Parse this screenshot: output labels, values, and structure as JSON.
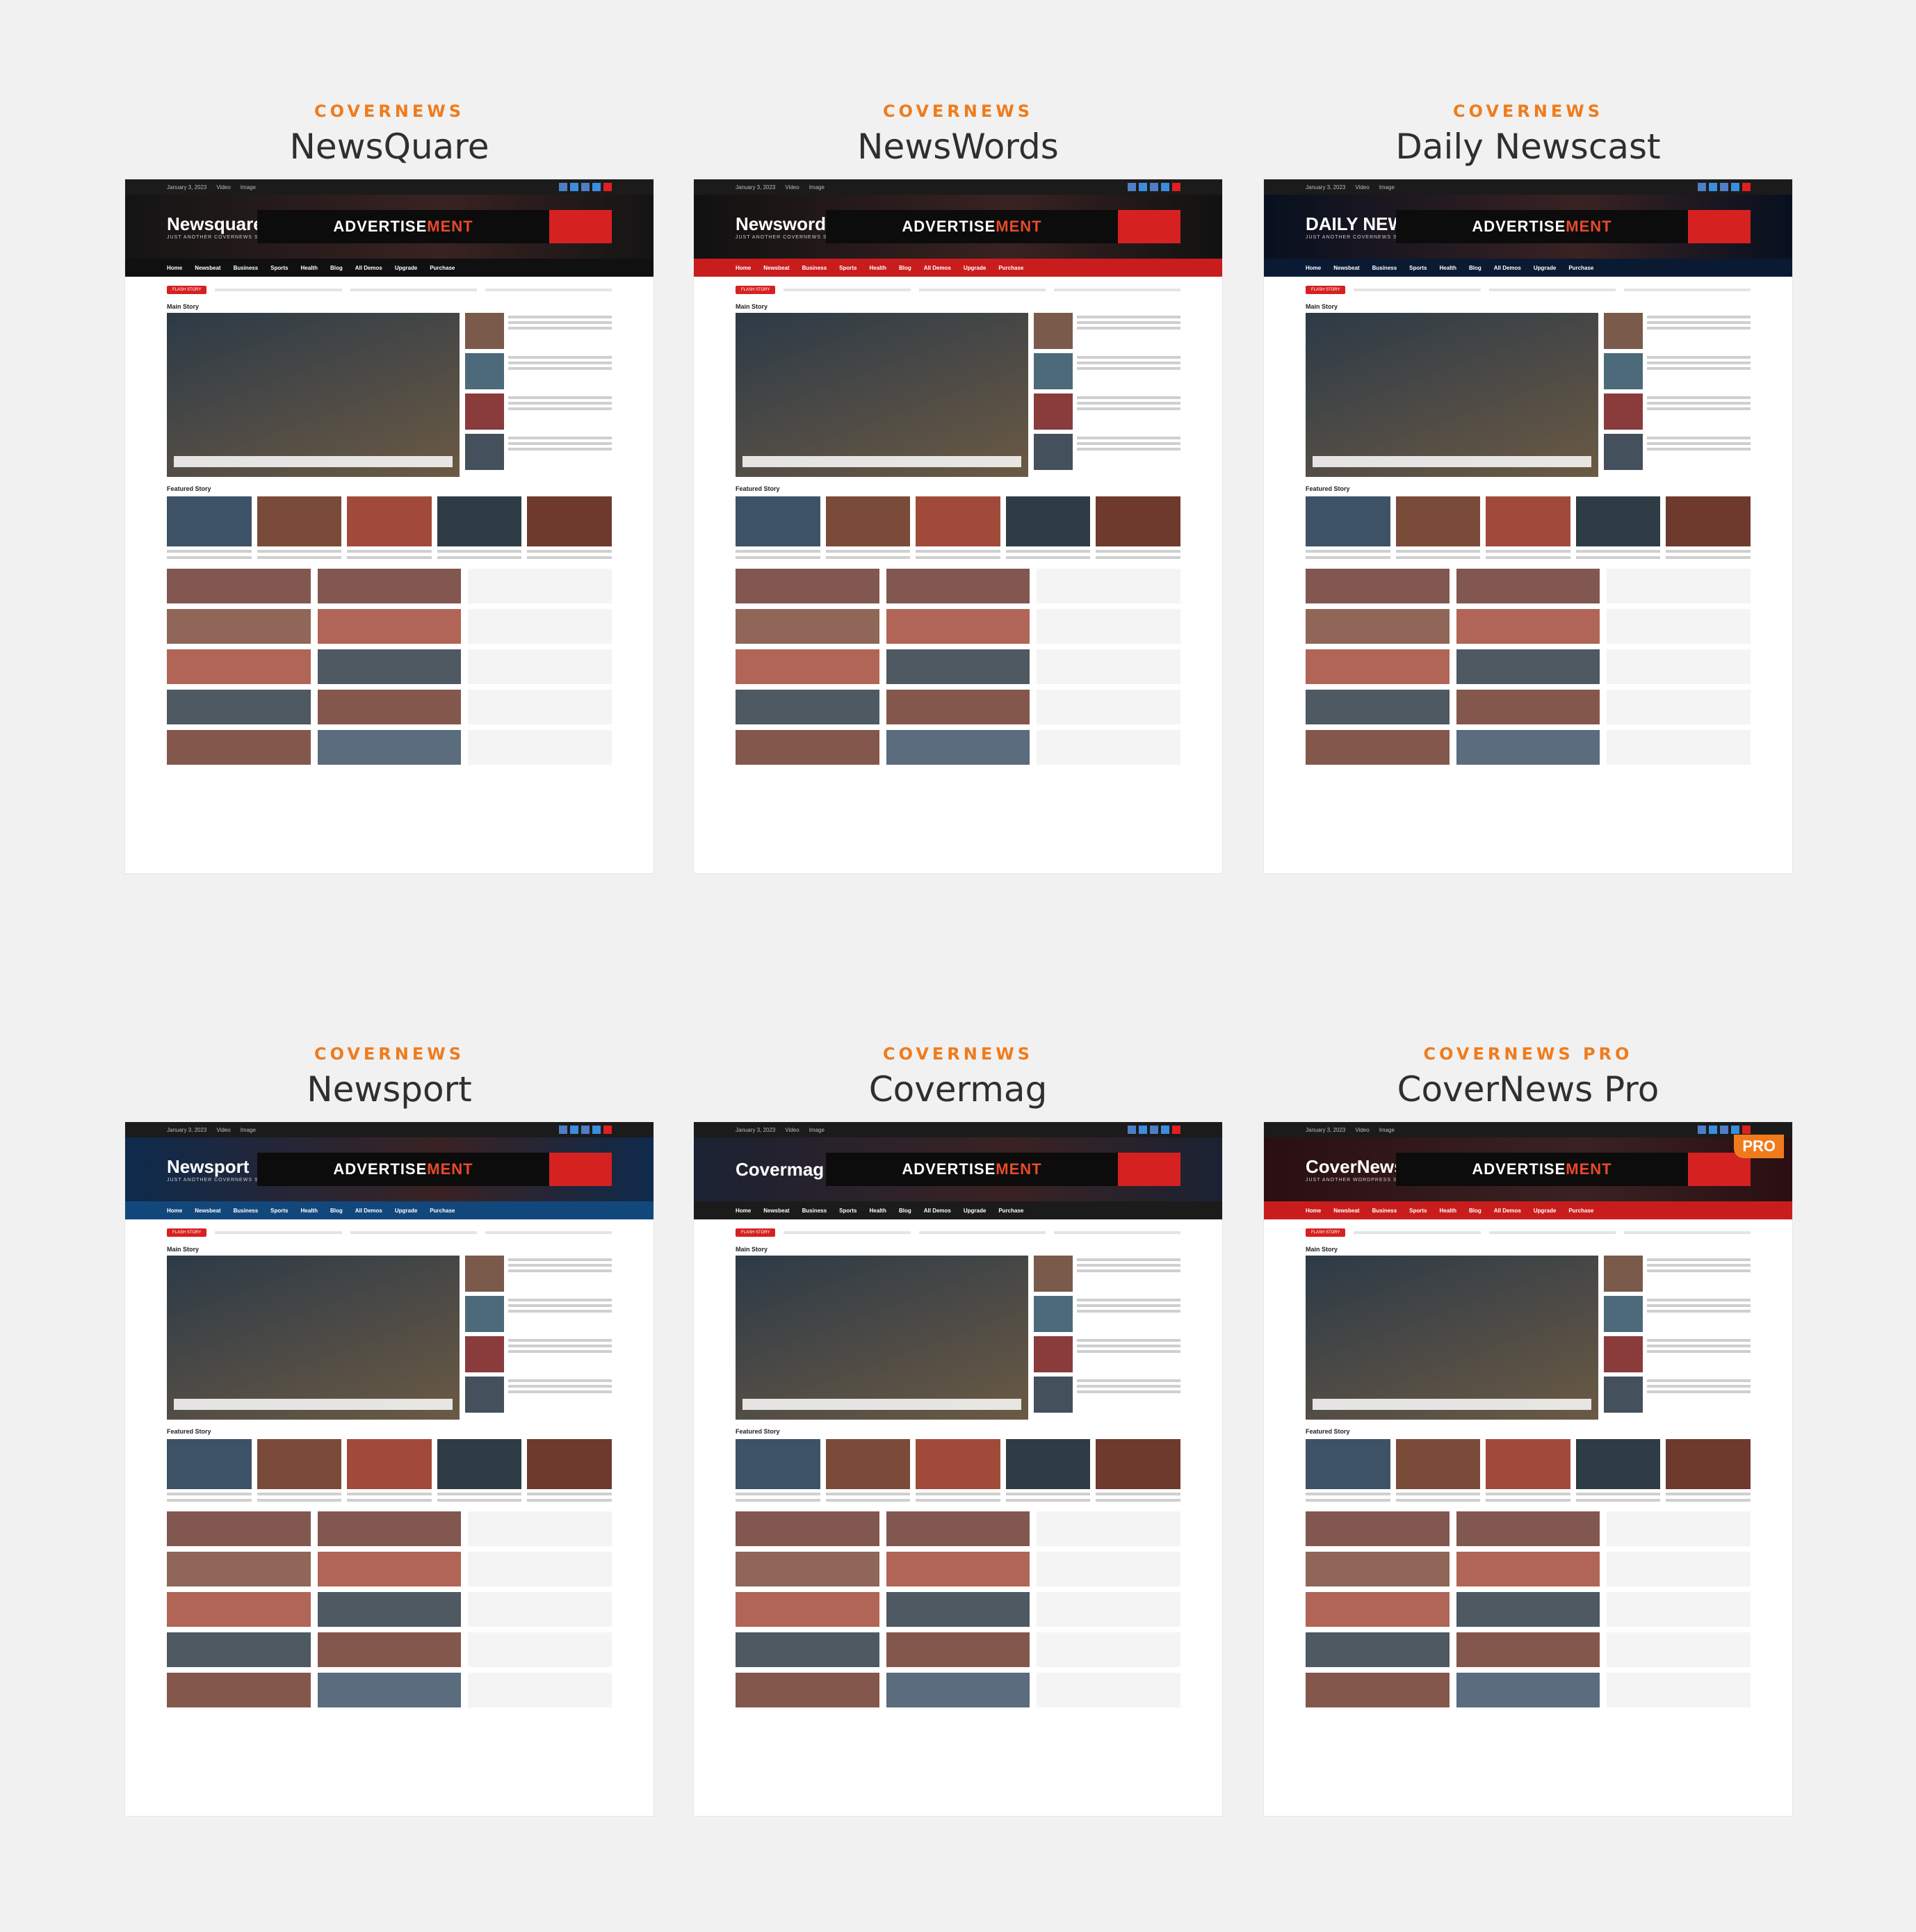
{
  "cards": [
    {
      "eyebrow": "COVERNEWS",
      "title": "NewsQuare",
      "site_name": "Newsquare",
      "tagline": "JUST ANOTHER COVERNEWS SITES SITE",
      "accent": "#d62121",
      "header_bg": "#141414",
      "nav_bg": "#101010"
    },
    {
      "eyebrow": "COVERNEWS",
      "title": "NewsWords",
      "site_name": "Newswords",
      "tagline": "JUST ANOTHER COVERNEWS SITES SITE",
      "accent": "#d62121",
      "header_bg": "#111111",
      "nav_bg": "#c91d1d"
    },
    {
      "eyebrow": "COVERNEWS",
      "title": "Daily Newscast",
      "site_name": "DAILY NEWSCAST",
      "tagline": "JUST ANOTHER COVERNEWS SITES SITE",
      "accent": "#d62121",
      "header_bg": "#07101f",
      "nav_bg": "#0b1a33"
    },
    {
      "eyebrow": "COVERNEWS",
      "title": "Newsport",
      "site_name": "Newsport",
      "tagline": "JUST ANOTHER COVERNEWS SITES SITE",
      "accent": "#d62121",
      "header_bg": "#0e2a4c",
      "nav_bg": "#12477c"
    },
    {
      "eyebrow": "COVERNEWS",
      "title": "Covermag",
      "site_name": "Covermag",
      "tagline": "",
      "accent": "#d62121",
      "header_bg": "#1a2233",
      "nav_bg": "#1b1b1b"
    },
    {
      "eyebrow": "COVERNEWS PRO",
      "title": "CoverNews Pro",
      "site_name": "CoverNews Pro",
      "tagline": "JUST ANOTHER WORDPRESS SITE",
      "accent": "#d62121",
      "header_bg": "#2a0f12",
      "nav_bg": "#c91d1d",
      "badge": "PRO"
    }
  ],
  "common": {
    "advert_prefix": "ADVERTISE",
    "advert_suffix": "MENT",
    "flash_label": "FLASH STORY",
    "main_story_label": "Main Story",
    "featured_story_label": "Featured Story",
    "nav_items": [
      "Home",
      "Newsbeat",
      "Business",
      "Sports",
      "Health",
      "Blog",
      "All Demos",
      "Upgrade",
      "Purchase"
    ],
    "topbar_items": [
      "January 3, 2023",
      "Video",
      "Image"
    ]
  }
}
